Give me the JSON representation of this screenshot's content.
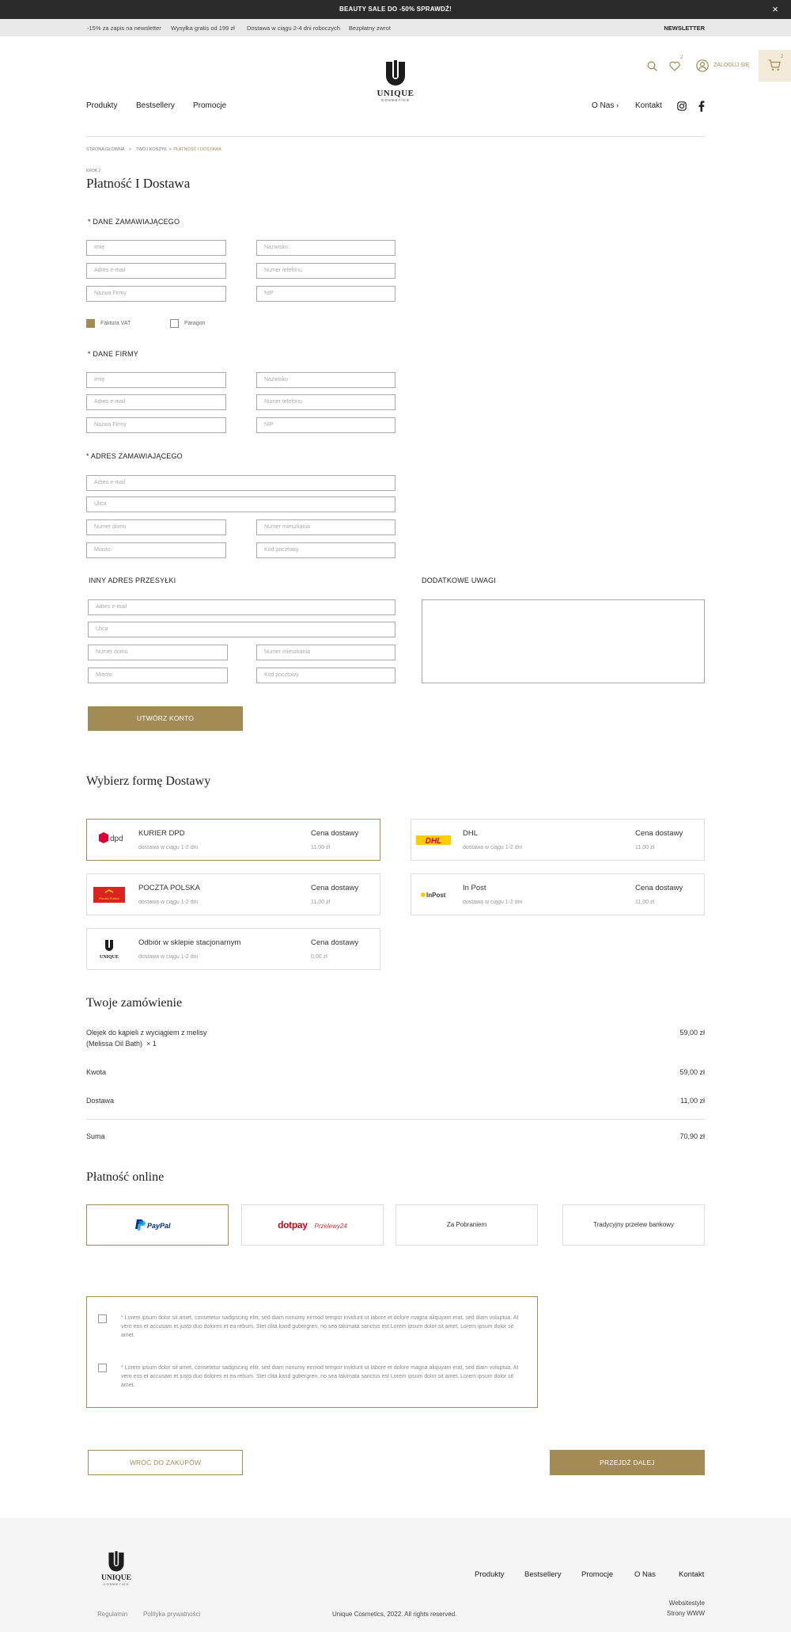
{
  "topbar": {
    "promo": "BEAUTY SALE DO -50% SPRAWDŹ!",
    "close": "×"
  },
  "infobar": {
    "items": [
      "-15% za zapis na newsletter",
      "Wysyłka gratis od 199 zł",
      "Dostawa w ciągu 2-4 dni roboczych",
      "Bezpłatny zwrot"
    ],
    "newsletter": "NEWSLETTER"
  },
  "header": {
    "nav_left": [
      "Produkty",
      "Bestsellery",
      "Promocje"
    ],
    "nav_right": [
      "O Nas",
      "Kontakt"
    ],
    "logo_title": "UNIQUE",
    "logo_sub": "COSMETICS",
    "wishlist_count": "2",
    "account_label": "ZALOGUJ SIĘ",
    "cart_count": "2"
  },
  "breadcrumb": {
    "home": "STRONA GŁÓWNA",
    "cart": "TWÓJ KOSZYK",
    "current": "PŁATNOŚĆ I DOSTAWA",
    "sep": ">"
  },
  "page": {
    "step": "KROK 2",
    "title": "Płatność I Dostawa"
  },
  "orderer": {
    "label": "* DANE ZAMAWIAJĄCEGO",
    "fields": [
      "Imię",
      "Nazwisko",
      "Adres e-mail",
      "Numer telefonu",
      "Nazwa Firmy",
      "NIP"
    ],
    "invoice": "Faktura VAT",
    "receipt": "Paragon"
  },
  "company": {
    "label": "* DANE FIRMY",
    "fields": [
      "Imię",
      "Nazwisko",
      "Adres e-mail",
      "Numer telefonu",
      "Nazwa Firmy",
      "NIP"
    ]
  },
  "address": {
    "label": "* ADRES ZAMAWIAJĄCEGO",
    "email": "Adres e-mail",
    "street": "Ulica",
    "house": "Numer domu",
    "flat": "Numer mieszkania",
    "city": "Miasto",
    "zip": "Kod pocztowy"
  },
  "shipping_address": {
    "label": "INNY ADRES PRZESYŁKI",
    "email": "Adres e-mail",
    "street": "Ulica",
    "house": "Numer domu",
    "flat": "Numer mieszkania",
    "city": "Miasto",
    "zip": "Kod pocztowy"
  },
  "notes": {
    "label": "DODATKOWE UWAGI"
  },
  "create_account": "UTWÓRZ KONTO",
  "delivery": {
    "title": "Wybierz formę Dostawy",
    "price_header": "Cena dostawy",
    "options": [
      {
        "name": "KURIER DPD",
        "desc": "dostawa w ciągu 1-2 dni",
        "price": "11,00 zł",
        "logo": "dpd",
        "selected": true
      },
      {
        "name": "DHL",
        "desc": "dostawa w ciągu 1-2 dni",
        "price": "11,00 zł",
        "logo": "DHL",
        "selected": false
      },
      {
        "name": "POCZTA POLSKA",
        "desc": "dostawa w ciągu 1-2 dni",
        "price": "11,00 zł",
        "logo": "Poczta Polska",
        "selected": false
      },
      {
        "name": "In Post",
        "desc": "dostawa w ciągu 1-2 dni",
        "price": "11,00 zł",
        "logo": "InPost",
        "selected": false
      },
      {
        "name": "Odbiór w sklepie stacjonarnym",
        "desc": "dostawa w ciągu 1-2 dni",
        "price": "0,00 zł",
        "logo": "UNIQUE",
        "selected": false
      }
    ]
  },
  "order": {
    "title": "Twoje zamówienie",
    "item_line1": "Olejek do kąpieli z wyciągiem z melisy",
    "item_line2": "(Melissa Oil Bath)",
    "item_qty": "× 1",
    "item_price": "59,00 zł",
    "amount_label": "Kwota",
    "amount": "59,00 zł",
    "delivery_label": "Dostawa",
    "delivery": "11,00 zł",
    "total_label": "Suma",
    "total": "70,90 zł"
  },
  "payment": {
    "title": "Płatność online",
    "options": [
      "PayPal",
      "dotpay",
      "Przelewy24",
      "Za Pobraniem",
      "Tradycyjny przelew bankowy"
    ]
  },
  "consents": [
    "* Lorem ipsum dolor sit amet, consetetur sadipscing elitr, sed diam nonumy eirmod tempor invidunt ut labore et dolore magna aliquyam erat, sed diam voluptua. At vero eos et accusam et justo duo dolores et ea rebum. Stet clita kasd gubergren, no sea takimata sanctus est Lorem ipsum dolor sit amet. Lorem ipsum dolor sit amet.",
    "* Lorem ipsum dolor sit amet, consetetur sadipscing elitr, sed diam nonumy eirmod tempor invidunt ut labore et dolore magna aliquyam erat, sed diam voluptua. At vero eos et accusam et justo duo dolores et ea rebum. Stet clita kasd gubergren, no sea takimata sanctus est Lorem ipsum dolor sit amet. Lorem ipsum dolor sit amet."
  ],
  "actions": {
    "back": "WRÓĆ DO ZAKUPÓW",
    "next": "PRZEJDŹ DALEJ"
  },
  "footer": {
    "logo_title": "UNIQUE",
    "logo_sub": "COSMETICS",
    "nav": [
      "Produkty",
      "Bestsellery",
      "Promocje",
      "O Nas",
      "Kontakt"
    ],
    "terms": "Regulamin",
    "privacy": "Polityka prywatności",
    "copyright": "Unique Cosmetics, 2022. All rights reserved.",
    "credit1": "Websitestyle",
    "credit2": "Strony WWW"
  },
  "colors": {
    "accent": "#a38b55",
    "dark": "#2b2b2b",
    "cart_bg": "#f3ead9"
  }
}
